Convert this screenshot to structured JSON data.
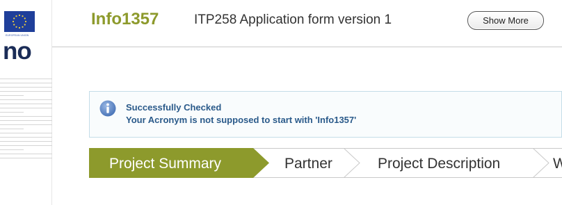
{
  "sidebar": {
    "eu_caption": "EUROPEAN UNION",
    "logo_fragment": "no"
  },
  "header": {
    "app_title": "Info1357",
    "form_name": "ITP258 Application form version 1",
    "show_more_label": "Show More"
  },
  "alert": {
    "title": "Successfully Checked",
    "message": "Your Acronym is not supposed to start with 'Info1357'"
  },
  "wizard": {
    "active_index": 0,
    "steps": [
      {
        "label": "Project Summary"
      },
      {
        "label": "Partner"
      },
      {
        "label": "Project Description"
      },
      {
        "label": "W"
      }
    ]
  },
  "colors": {
    "accent": "#8d9a2c",
    "step_active": "#8d9a2c",
    "info_text": "#2a5a8a",
    "info_icon": "#5b86c5"
  }
}
